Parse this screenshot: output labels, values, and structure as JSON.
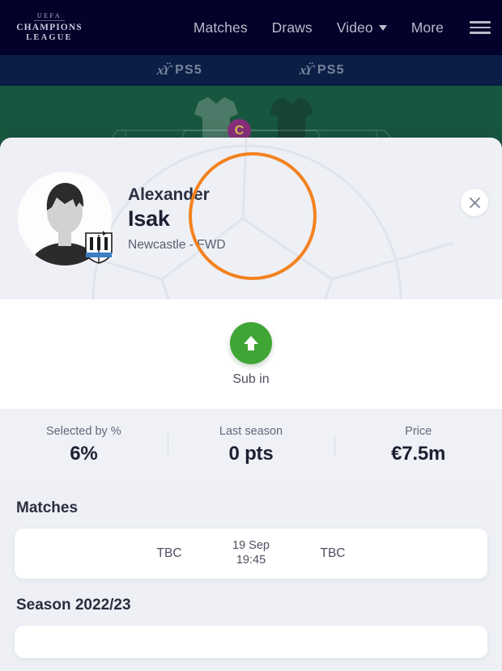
{
  "nav": {
    "logo": {
      "arc": "UEFA",
      "line1": "CHAMPIONS",
      "line2": "LEAGUE"
    },
    "links": [
      {
        "label": "Matches",
        "caret": false
      },
      {
        "label": "Draws",
        "caret": false
      },
      {
        "label": "Video",
        "caret": true
      },
      {
        "label": "More",
        "caret": false
      }
    ],
    "menu_icon": "hamburger-icon"
  },
  "sponsor": {
    "logos": [
      {
        "mark": "PS",
        "name": "PS5"
      },
      {
        "mark": "PS",
        "name": "PS5"
      }
    ]
  },
  "pitch": {
    "captain_badge": "C"
  },
  "player": {
    "first_name": "Alexander",
    "last_name": "Isak",
    "meta": "Newcastle - FWD",
    "avatar_icon": "player-silhouette-avatar",
    "crest_icon": "newcastle-united-crest"
  },
  "close": {
    "icon": "close-icon"
  },
  "action": {
    "label": "Sub in",
    "icon": "arrow-up-icon",
    "color": "#3fa535",
    "highlight_color": "#f3821f"
  },
  "stats": [
    {
      "label": "Selected by %",
      "value": "6%"
    },
    {
      "label": "Last season",
      "value": "0 pts"
    },
    {
      "label": "Price",
      "value": "€7.5m"
    }
  ],
  "matches": {
    "title": "Matches",
    "rows": [
      {
        "home": "TBC",
        "date": "19 Sep",
        "time": "19:45",
        "away": "TBC"
      }
    ]
  },
  "season": {
    "title": "Season 2022/23"
  }
}
